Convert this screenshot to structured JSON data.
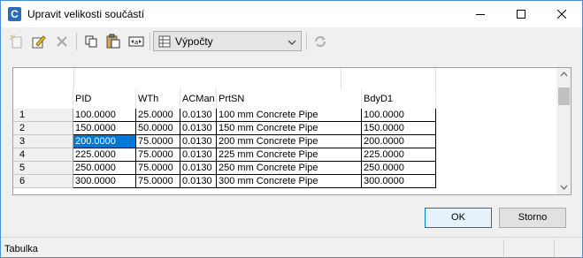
{
  "window": {
    "title": "Upravit velikosti součástí",
    "icon_letter": "C"
  },
  "toolbar": {
    "combo_value": "Výpočty"
  },
  "grid": {
    "columns": [
      "PID",
      "WTh",
      "ACMan",
      "PrtSN",
      "BdyD1"
    ],
    "rows": [
      {
        "num": "1",
        "cells": [
          "100.0000",
          "25.0000",
          "0.0130",
          "100 mm Concrete Pipe",
          "100.0000"
        ]
      },
      {
        "num": "2",
        "cells": [
          "150.0000",
          "50.0000",
          "0.0130",
          "150 mm Concrete Pipe",
          "150.0000"
        ]
      },
      {
        "num": "3",
        "cells": [
          "200.0000",
          "75.0000",
          "0.0130",
          "200 mm Concrete Pipe",
          "200.0000"
        ]
      },
      {
        "num": "4",
        "cells": [
          "225.0000",
          "75.0000",
          "0.0130",
          "225 mm Concrete Pipe",
          "225.0000"
        ]
      },
      {
        "num": "5",
        "cells": [
          "250.0000",
          "75.0000",
          "0.0130",
          "250 mm Concrete Pipe",
          "250.0000"
        ]
      },
      {
        "num": "6",
        "cells": [
          "300.0000",
          "75.0000",
          "0.0130",
          "300 mm Concrete Pipe",
          "300.0000"
        ]
      }
    ]
  },
  "buttons": {
    "ok": "OK",
    "cancel": "Storno"
  },
  "status": {
    "text": "Tabulka"
  }
}
